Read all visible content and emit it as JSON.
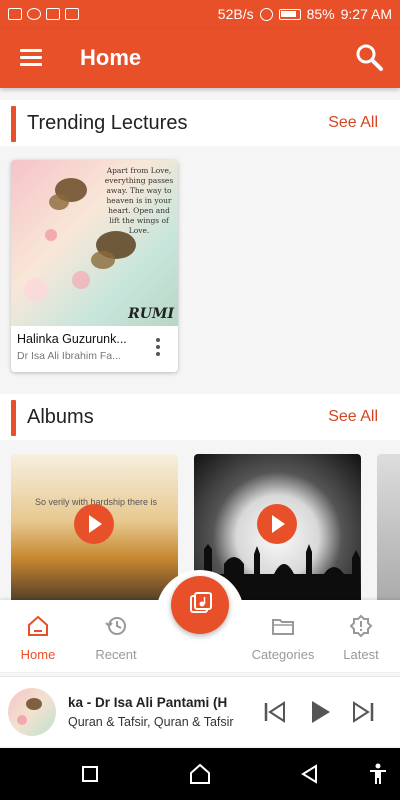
{
  "status_bar": {
    "network_speed": "52B/s",
    "battery": "85%",
    "time": "9:27 AM"
  },
  "app_bar": {
    "title": "Home"
  },
  "sections": {
    "trending": {
      "title": "Trending Lectures",
      "see_all": "See All"
    },
    "albums": {
      "title": "Albums",
      "see_all": "See All"
    }
  },
  "trending_card": {
    "quote": "Apart from Love, everything passes away. The way to heaven is in your heart. Open and lift the wings of Love.",
    "signature": "RUMI",
    "title": "Halinka Guzurunk...",
    "author": "Dr Isa Ali Ibrahim Fa..."
  },
  "album_cards": [
    {
      "caption": "So verily with hardship there is relief"
    }
  ],
  "bottom_nav": {
    "items": [
      {
        "label": "Home",
        "icon": "home-icon"
      },
      {
        "label": "Recent",
        "icon": "history-icon"
      },
      {
        "label": "Categories",
        "icon": "folder-icon"
      },
      {
        "label": "Latest",
        "icon": "alert-icon"
      }
    ]
  },
  "mini_player": {
    "title": "ka - Dr Isa Ali Pantami (H",
    "subtitle": "Quran & Tafsir, Quran & Tafsir"
  },
  "colors": {
    "accent": "#e8502a"
  }
}
